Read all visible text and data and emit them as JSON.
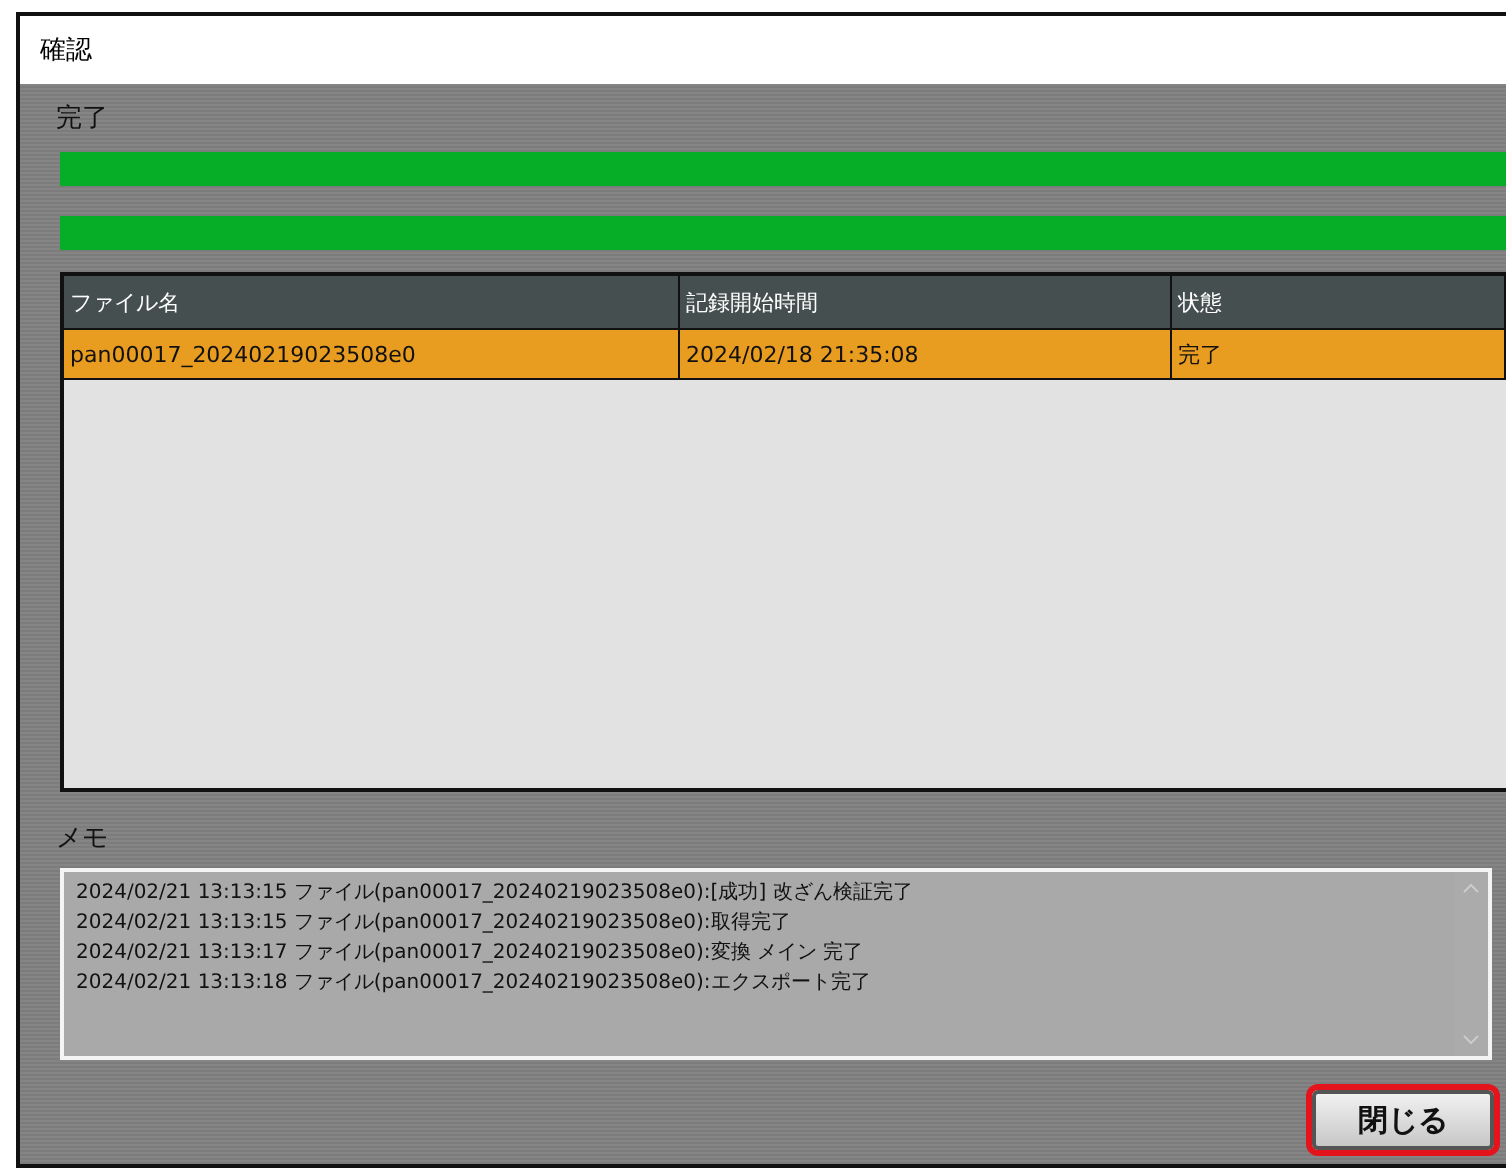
{
  "window": {
    "title": "確認"
  },
  "status_label": "完了",
  "progress_bars": [
    {
      "level": 1
    },
    {
      "level": 1
    }
  ],
  "table": {
    "columns": [
      "ファイル名",
      "記録開始時間",
      "状態"
    ],
    "rows": [
      {
        "cells": [
          "pan00017_20240219023508e0",
          "2024/02/18 21:35:08",
          "完了"
        ],
        "selected": true
      }
    ]
  },
  "memo": {
    "label": "メモ",
    "lines": [
      "2024/02/21 13:13:15 ファイル(pan00017_20240219023508e0):[成功] 改ざん検証完了",
      "2024/02/21 13:13:15 ファイル(pan00017_20240219023508e0):取得完了",
      "2024/02/21 13:13:17 ファイル(pan00017_20240219023508e0):変換 メイン 完了",
      "2024/02/21 13:13:18 ファイル(pan00017_20240219023508e0):エクスポート完了"
    ]
  },
  "close_button": {
    "label": "閉じる",
    "highlighted": true
  }
}
